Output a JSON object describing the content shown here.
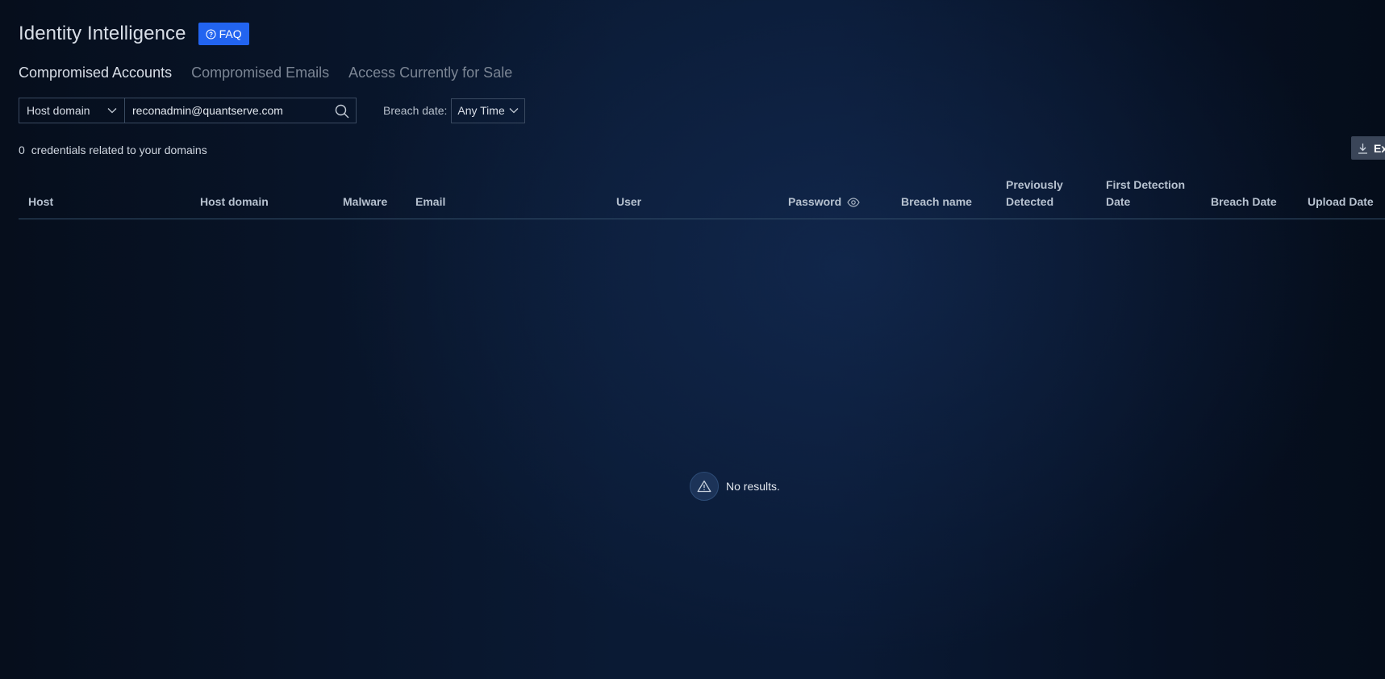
{
  "header": {
    "title": "Identity Intelligence",
    "faq_label": "FAQ"
  },
  "tabs": [
    {
      "label": "Compromised Accounts",
      "active": true
    },
    {
      "label": "Compromised Emails",
      "active": false
    },
    {
      "label": "Access Currently for Sale",
      "active": false
    }
  ],
  "filters": {
    "search_field_selected": "Host domain",
    "search_value": "reconadmin@quantserve.com",
    "breach_date_label": "Breach date:",
    "breach_date_value": "Any Time"
  },
  "summary": {
    "count": "0",
    "text": "credentials related to your domains"
  },
  "export": {
    "label": "Ex"
  },
  "table": {
    "columns": [
      {
        "line1": "Host",
        "line2": ""
      },
      {
        "line1": "Host domain",
        "line2": ""
      },
      {
        "line1": "Malware",
        "line2": ""
      },
      {
        "line1": "Email",
        "line2": ""
      },
      {
        "line1": "User",
        "line2": ""
      },
      {
        "line1": "Password",
        "line2": ""
      },
      {
        "line1": "Breach name",
        "line2": ""
      },
      {
        "line1": "Previously",
        "line2": "Detected"
      },
      {
        "line1": "First Detection",
        "line2": "Date"
      },
      {
        "line1": "Breach Date",
        "line2": ""
      },
      {
        "line1": "Upload Date",
        "line2": ""
      }
    ],
    "rows": [],
    "empty_message": "No results."
  },
  "colors": {
    "accent": "#2264f0",
    "background": "#0a1a34",
    "border": "#3a4a61"
  }
}
